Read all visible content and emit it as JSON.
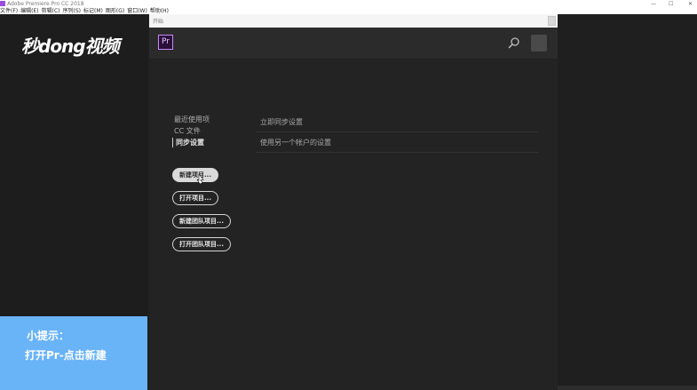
{
  "window": {
    "title": "Adobe Premiere Pro CC 2018",
    "min": "—",
    "max": "☐",
    "close": "✕"
  },
  "menu": [
    "文件(F)",
    "编辑(E)",
    "剪辑(C)",
    "序列(S)",
    "标记(M)",
    "图形(G)",
    "窗口(W)",
    "帮助(H)"
  ],
  "brand": {
    "logo_text": "秒dong视频"
  },
  "dialog": {
    "title": "开始",
    "app_badge": "Pr",
    "nav": [
      {
        "label": "最近使用项"
      },
      {
        "label": "CC 文件"
      },
      {
        "label": "同步设置",
        "active": true
      }
    ],
    "sync_rows": [
      {
        "label": "立即同步设置"
      },
      {
        "label": "使用另一个帐户的设置"
      }
    ],
    "buttons": [
      {
        "label": "新建项目..."
      },
      {
        "label": "打开项目..."
      },
      {
        "label": "新建团队项目..."
      },
      {
        "label": "打开团队项目..."
      }
    ]
  },
  "tip": {
    "title": "小提示：",
    "text": "打开Pr-点击新建"
  },
  "colors": {
    "accent_purple": "#c58af9",
    "tip_blue": "#69b3f7"
  }
}
